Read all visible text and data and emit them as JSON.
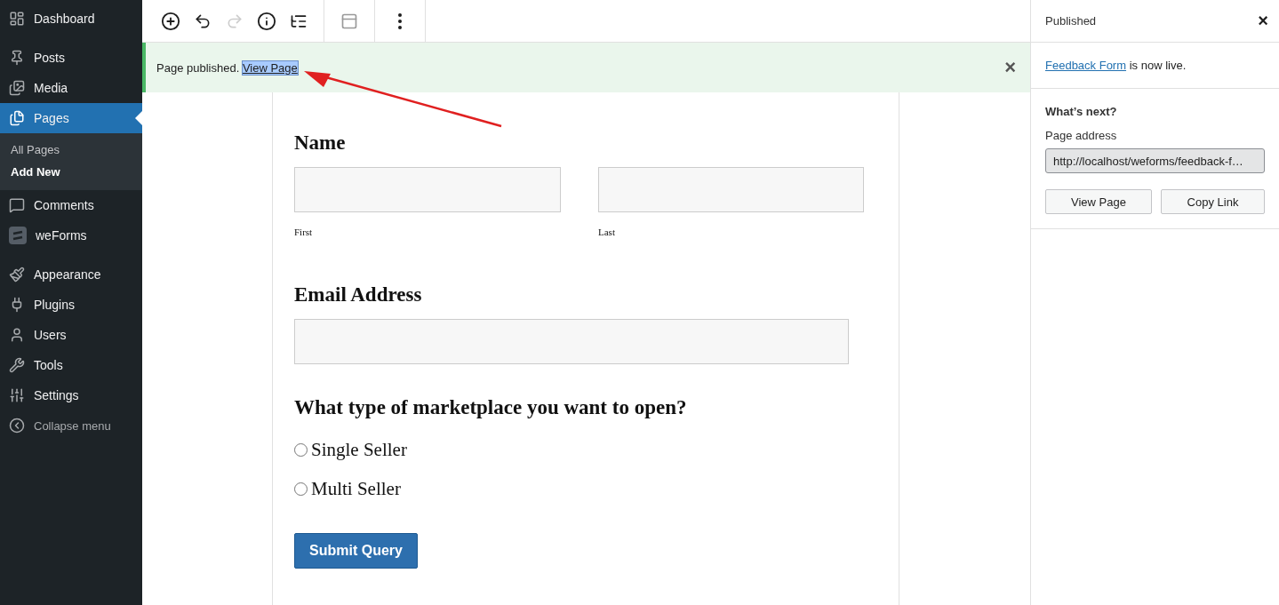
{
  "sidebar": {
    "items": [
      {
        "label": "Dashboard",
        "selected": false
      },
      {
        "label": "Posts",
        "selected": false
      },
      {
        "label": "Media",
        "selected": false
      },
      {
        "label": "Pages",
        "selected": true,
        "children": [
          {
            "label": "All Pages",
            "selected": false
          },
          {
            "label": "Add New",
            "selected": true
          }
        ]
      },
      {
        "label": "Comments",
        "selected": false
      },
      {
        "label": "weForms",
        "selected": false
      },
      {
        "label": "Appearance",
        "selected": false
      },
      {
        "label": "Plugins",
        "selected": false
      },
      {
        "label": "Users",
        "selected": false
      },
      {
        "label": "Tools",
        "selected": false
      },
      {
        "label": "Settings",
        "selected": false
      }
    ],
    "collapse": "Collapse menu"
  },
  "toolbar": {
    "redo_disabled": true
  },
  "notice": {
    "text": "Page published.",
    "link": "View Page",
    "close": "×"
  },
  "form": {
    "name": {
      "heading": "Name",
      "sublabels": [
        "First",
        "Last"
      ]
    },
    "email": {
      "heading": "Email Address"
    },
    "question": {
      "heading": "What type of marketplace you want to open?",
      "options": [
        {
          "label": "Single Seller",
          "selected": false
        },
        {
          "label": "Multi Seller",
          "selected": false
        }
      ]
    },
    "submit": "Submit Query"
  },
  "panel": {
    "title": "Published",
    "close": "×",
    "link": "Feedback Form",
    "live_text": "is now live.",
    "next_heading": "What’s next?",
    "address_label": "Page address",
    "address": "http://localhost/weforms/feedback-f…",
    "buttons": [
      "View Page",
      "Copy Link"
    ]
  }
}
